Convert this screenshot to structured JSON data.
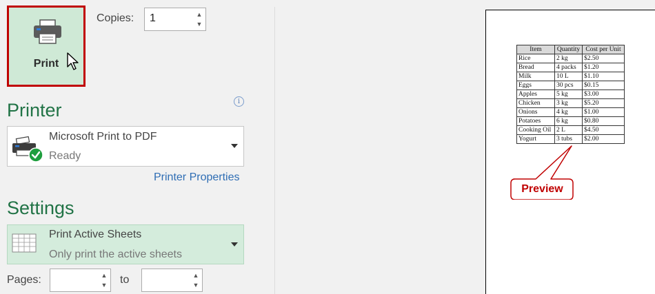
{
  "print": {
    "label": "Print"
  },
  "copies": {
    "label": "Copies:",
    "value": "1"
  },
  "printer": {
    "section_title": "Printer",
    "name": "Microsoft Print to PDF",
    "status": "Ready",
    "properties_link": "Printer Properties"
  },
  "settings": {
    "section_title": "Settings",
    "option_title": "Print Active Sheets",
    "option_desc": "Only print the active sheets"
  },
  "pages": {
    "label": "Pages:",
    "to_label": "to",
    "from_value": "",
    "to_value": ""
  },
  "preview": {
    "headers": [
      "Item",
      "Quantity",
      "Cost per Unit"
    ],
    "rows": [
      [
        "Rice",
        "2 kg",
        "$2.50"
      ],
      [
        "Bread",
        "4 packs",
        "$1.20"
      ],
      [
        "Milk",
        "10 L",
        "$1.10"
      ],
      [
        "Eggs",
        "30 pcs",
        "$0.15"
      ],
      [
        "Apples",
        "5 kg",
        "$3.00"
      ],
      [
        "Chicken",
        "3 kg",
        "$5.20"
      ],
      [
        "Onions",
        "4 kg",
        "$1.00"
      ],
      [
        "Potatoes",
        "6 kg",
        "$0.80"
      ],
      [
        "Cooking Oil",
        "2 L",
        "$4.50"
      ],
      [
        "Yogurt",
        "3 tubs",
        "$2.00"
      ]
    ],
    "callout": "Preview"
  },
  "colors": {
    "accent_green": "#217346",
    "highlight_red": "#c00000",
    "link_blue": "#2e6db4",
    "print_button_bg": "#cfe9d6"
  }
}
